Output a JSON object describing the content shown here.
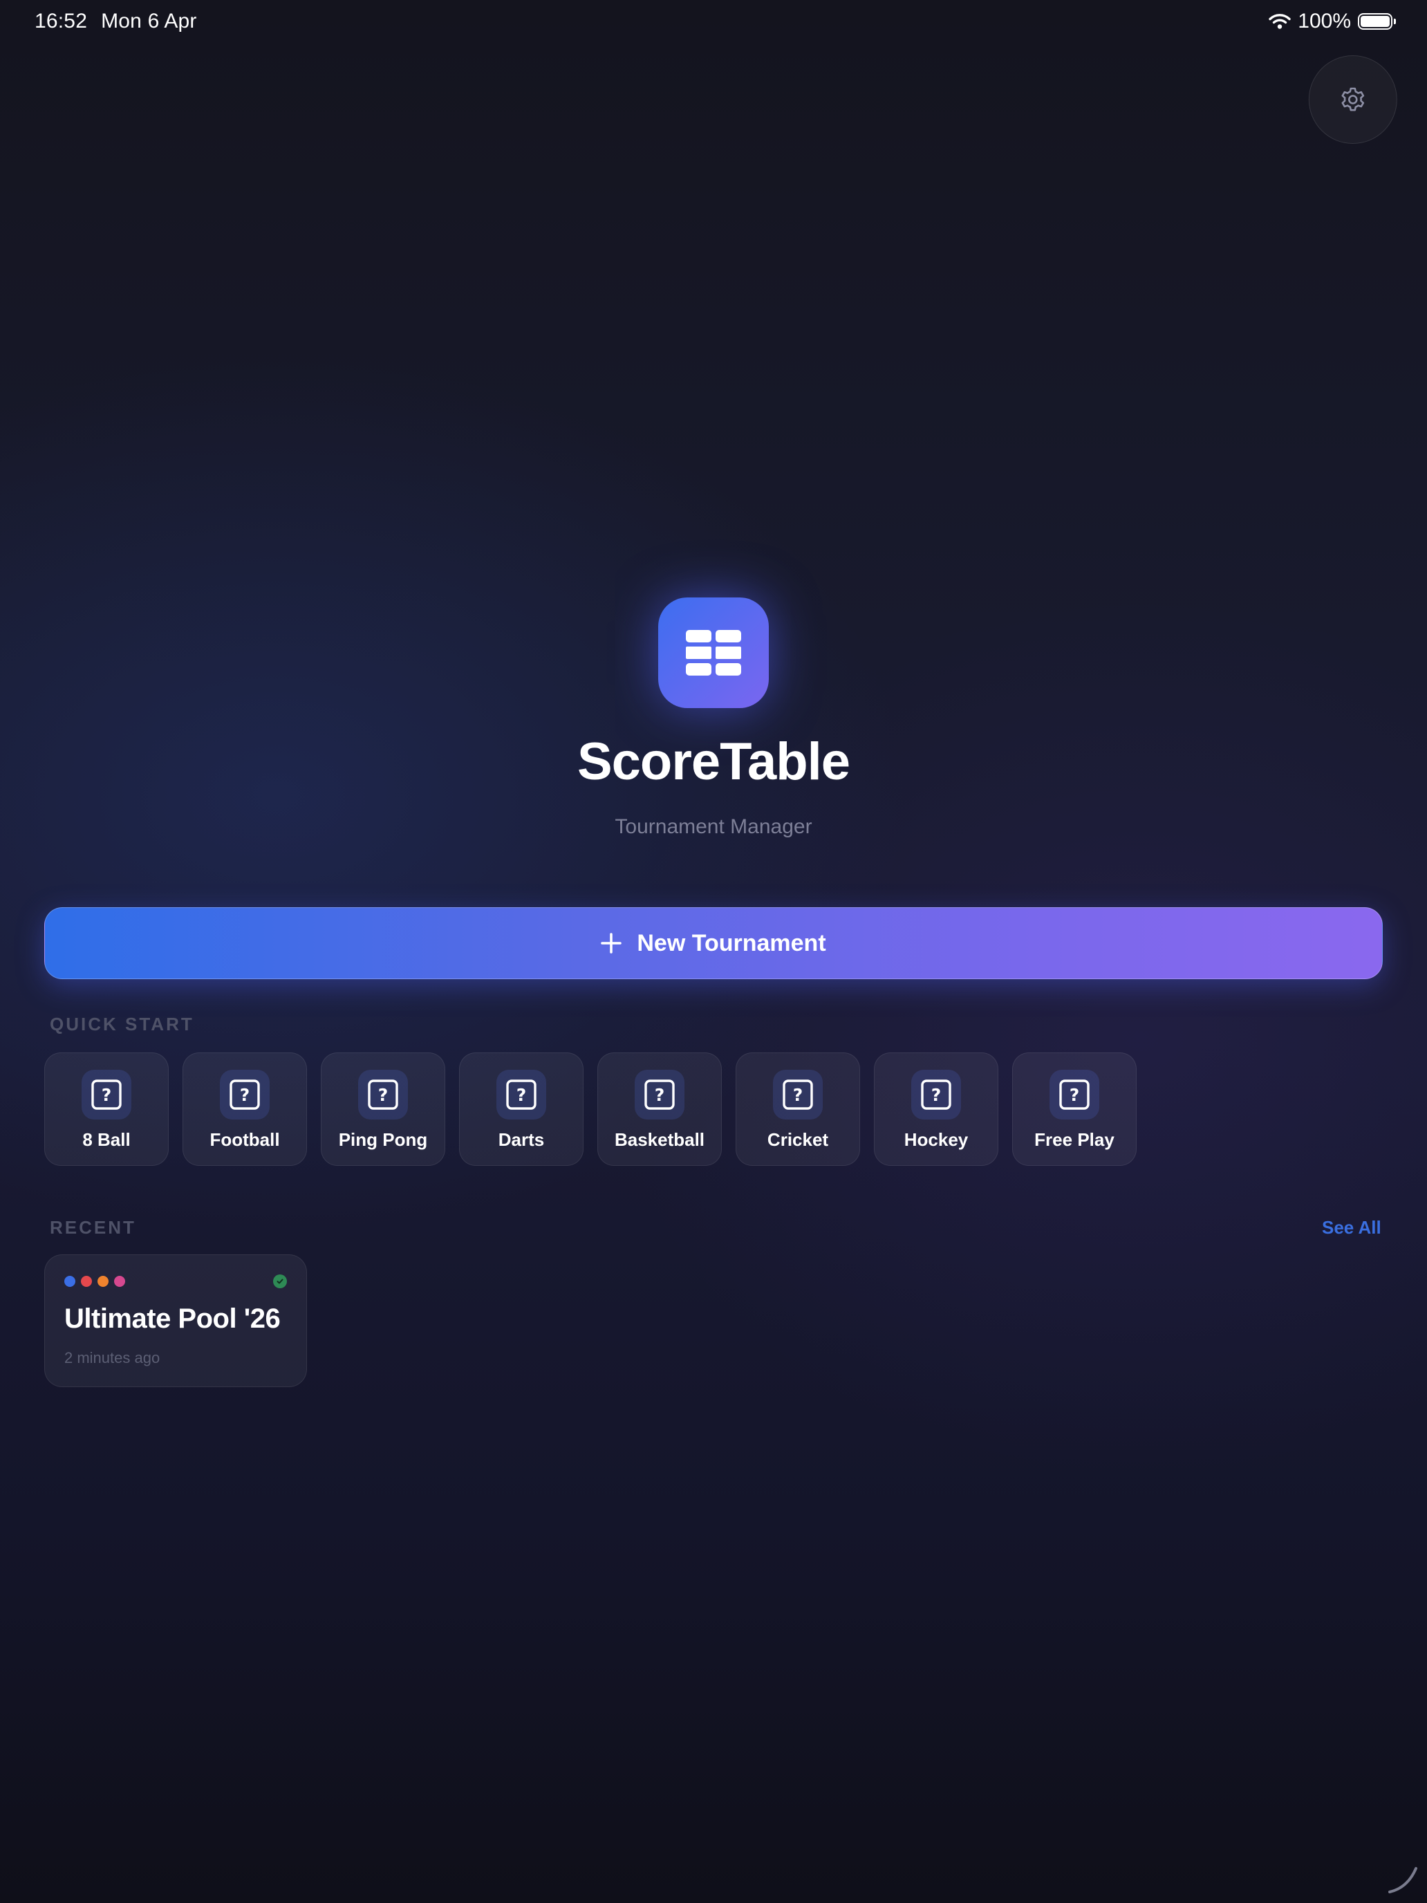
{
  "status_bar": {
    "time": "16:52",
    "date": "Mon 6 Apr",
    "battery_text": "100%",
    "battery_level": 1.0,
    "icons": [
      "wifi-icon",
      "battery-icon"
    ]
  },
  "header": {
    "settings_icon": "gear-icon"
  },
  "hero": {
    "app_icon": "table-grid-icon",
    "title": "ScoreTable",
    "subtitle": "Tournament Manager"
  },
  "primary_action": {
    "icon": "plus-icon",
    "label": "New Tournament"
  },
  "quick_start": {
    "label": "QUICK START",
    "items": [
      {
        "label": "8 Ball",
        "icon": "question-square-icon"
      },
      {
        "label": "Football",
        "icon": "question-square-icon"
      },
      {
        "label": "Ping Pong",
        "icon": "question-square-icon"
      },
      {
        "label": "Darts",
        "icon": "question-square-icon"
      },
      {
        "label": "Basketball",
        "icon": "question-square-icon"
      },
      {
        "label": "Cricket",
        "icon": "question-square-icon"
      },
      {
        "label": "Hockey",
        "icon": "question-square-icon"
      },
      {
        "label": "Free Play",
        "icon": "question-square-icon"
      }
    ]
  },
  "recent": {
    "label": "RECENT",
    "see_all": "See All",
    "items": [
      {
        "title": "Ultimate Pool '26",
        "time": "2 minutes ago",
        "status": "completed",
        "status_icon": "check-circle-icon",
        "player_colors": [
          "#3b6fe6",
          "#e5484d",
          "#f0832e",
          "#d6488f"
        ]
      }
    ]
  },
  "colors": {
    "accent_start": "#2f6ee8",
    "accent_end": "#8a68ee",
    "link": "#3a6fe0",
    "success": "#2e8a55"
  }
}
